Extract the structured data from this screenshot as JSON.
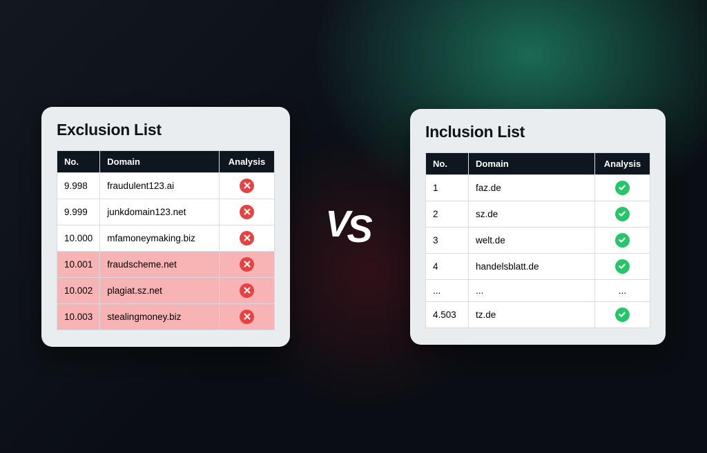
{
  "exclusion": {
    "title": "Exclusion List",
    "columns": {
      "c1": "No.",
      "c2": "Domain",
      "c3": "Analysis"
    },
    "rows": [
      {
        "no": "9.998",
        "domain": "fraudulent123.ai",
        "highlight": false
      },
      {
        "no": "9.999",
        "domain": "junkdomain123.net",
        "highlight": false
      },
      {
        "no": "10.000",
        "domain": "mfamoneymaking.biz",
        "highlight": false
      },
      {
        "no": "10.001",
        "domain": "fraudscheme.net",
        "highlight": true
      },
      {
        "no": "10.002",
        "domain": "plagiat.sz.net",
        "highlight": true
      },
      {
        "no": "10.003",
        "domain": "stealingmoney.biz",
        "highlight": true
      }
    ]
  },
  "vs": "VS",
  "inclusion": {
    "title": "Inclusion List",
    "columns": {
      "c1": "No.",
      "c2": "Domain",
      "c3": "Analysis"
    },
    "rows": [
      {
        "no": "1",
        "domain": "faz.de",
        "analysis": "ok"
      },
      {
        "no": "2",
        "domain": "sz.de",
        "analysis": "ok"
      },
      {
        "no": "3",
        "domain": "welt.de",
        "analysis": "ok"
      },
      {
        "no": "4",
        "domain": "handelsblatt.de",
        "analysis": "ok"
      },
      {
        "no": "...",
        "domain": "...",
        "analysis": "..."
      },
      {
        "no": "4.503",
        "domain": "tz.de",
        "analysis": "ok"
      }
    ]
  },
  "icons": {
    "cross": "cross-icon",
    "check": "check-icon"
  },
  "colors": {
    "red": "#e8413f",
    "green": "#24c768",
    "header": "#0e1720",
    "card": "#e9edef"
  }
}
